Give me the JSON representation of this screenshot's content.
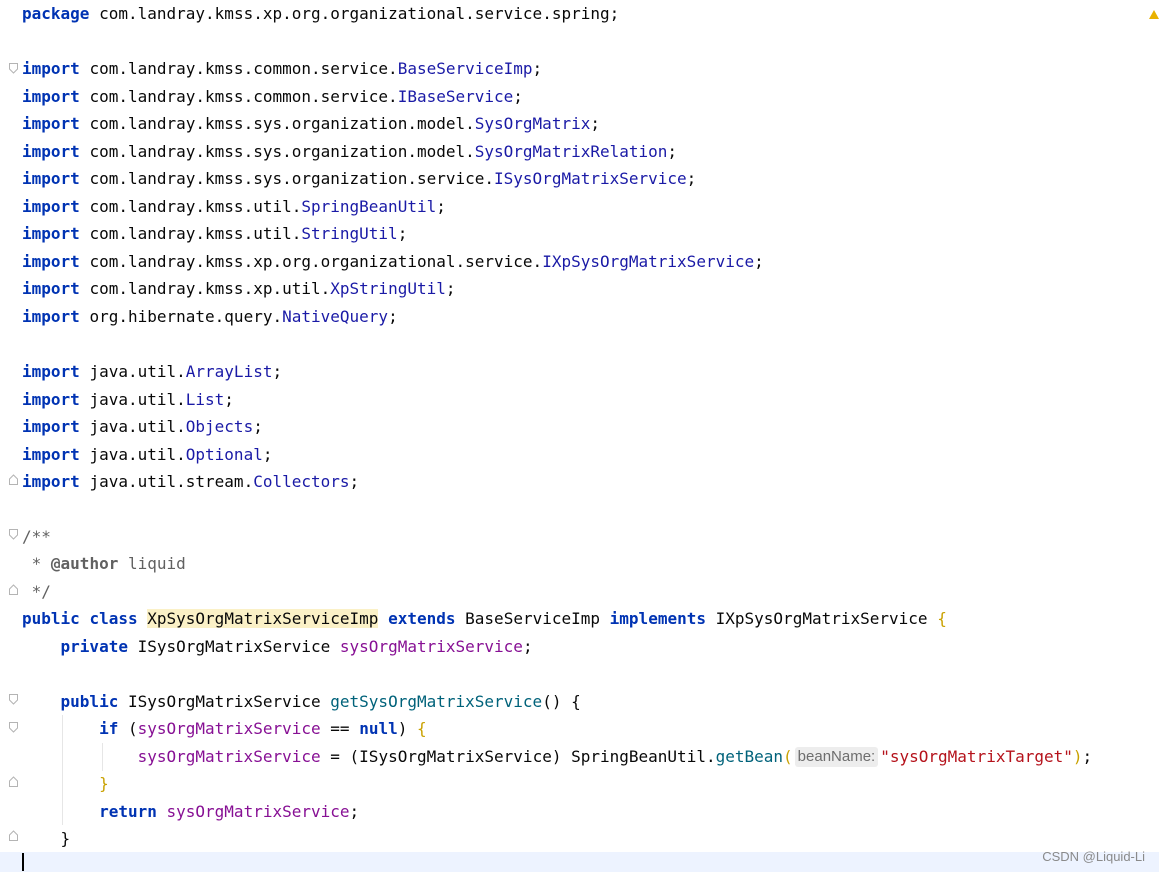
{
  "editor": {
    "lines": {
      "package_kw": "package",
      "package_name": "com.landray.kmss.xp.org.organizational.service.spring",
      "import_kw": "import",
      "imports_a": [
        {
          "prefix": "com.landray.kmss.common.service.",
          "name": "BaseServiceImp"
        },
        {
          "prefix": "com.landray.kmss.common.service.",
          "name": "IBaseService"
        },
        {
          "prefix": "com.landray.kmss.sys.organization.model.",
          "name": "SysOrgMatrix"
        },
        {
          "prefix": "com.landray.kmss.sys.organization.model.",
          "name": "SysOrgMatrixRelation"
        },
        {
          "prefix": "com.landray.kmss.sys.organization.service.",
          "name": "ISysOrgMatrixService"
        },
        {
          "prefix": "com.landray.kmss.util.",
          "name": "SpringBeanUtil"
        },
        {
          "prefix": "com.landray.kmss.util.",
          "name": "StringUtil"
        },
        {
          "prefix": "com.landray.kmss.xp.org.organizational.service.",
          "name": "IXpSysOrgMatrixService"
        },
        {
          "prefix": "com.landray.kmss.xp.util.",
          "name": "XpStringUtil"
        },
        {
          "prefix": "org.hibernate.query.",
          "name": "NativeQuery"
        }
      ],
      "imports_b": [
        {
          "prefix": "java.util.",
          "name": "ArrayList"
        },
        {
          "prefix": "java.util.",
          "name": "List"
        },
        {
          "prefix": "java.util.",
          "name": "Objects"
        },
        {
          "prefix": "java.util.",
          "name": "Optional"
        },
        {
          "prefix": "java.util.stream.",
          "name": "Collectors"
        }
      ],
      "doc_open": "/**",
      "doc_star": " * ",
      "doc_tag": "@author",
      "doc_author": " liquid",
      "doc_close": " */",
      "public_kw": "public",
      "class_kw": "class",
      "class_name": "XpSysOrgMatrixServiceImp",
      "extends_kw": "extends",
      "base_class": "BaseServiceImp",
      "implements_kw": "implements",
      "iface_name": "IXpSysOrgMatrixService",
      "private_kw": "private",
      "field_type": "ISysOrgMatrixService",
      "field_name": "sysOrgMatrixService",
      "method_name": "getSysOrgMatrixService",
      "if_kw": "if",
      "eq_op": "==",
      "null_kw": "null",
      "cast_type": "ISysOrgMatrixService",
      "util_class": "SpringBeanUtil",
      "get_bean": "getBean",
      "hint_label": "beanName:",
      "bean_string": "\"sysOrgMatrixTarget\"",
      "return_kw": "return"
    }
  },
  "watermark": "CSDN @Liquid-Li"
}
